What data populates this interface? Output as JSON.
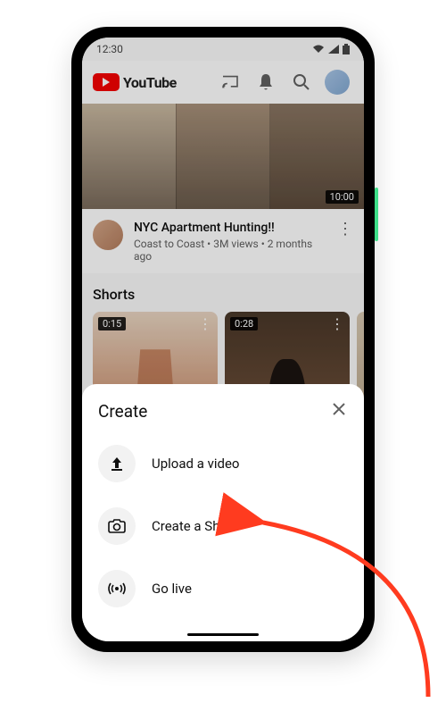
{
  "statusbar": {
    "time": "12:30"
  },
  "appbar": {
    "brand": "YouTube"
  },
  "feed": {
    "video": {
      "duration": "10:00",
      "title": "NYC Apartment Hunting!!",
      "meta": "Coast to Coast • 3M views • 2 months ago"
    },
    "shorts_header": "Shorts",
    "shorts": [
      {
        "duration": "0:15"
      },
      {
        "duration": "0:28"
      }
    ]
  },
  "sheet": {
    "title": "Create",
    "items": [
      {
        "label": "Upload a video"
      },
      {
        "label": "Create a Short"
      },
      {
        "label": "Go live"
      }
    ]
  }
}
